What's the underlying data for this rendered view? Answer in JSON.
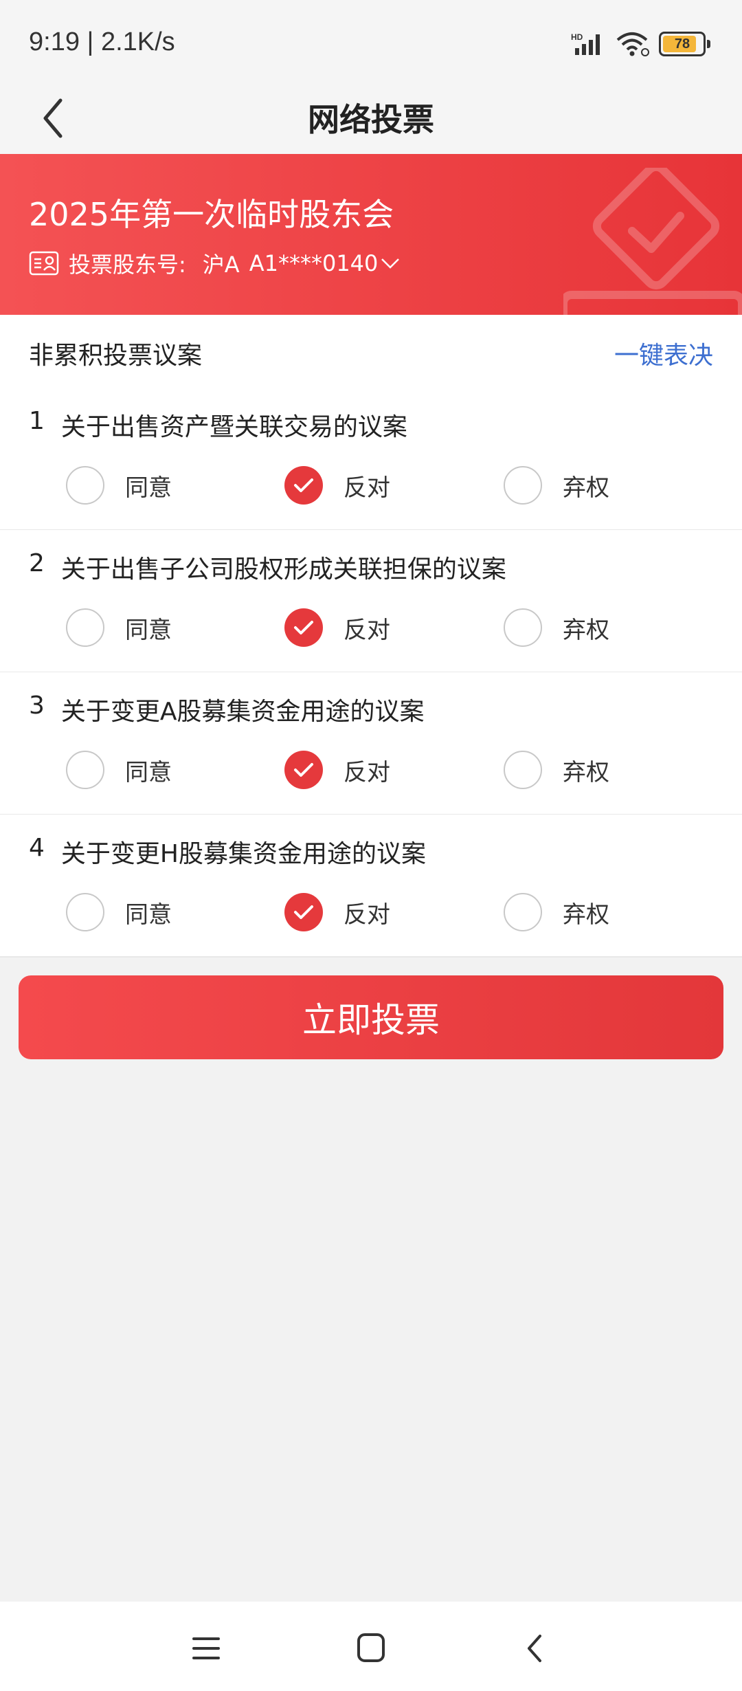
{
  "status_bar": {
    "time": "9:19 | 2.1K/s",
    "battery": "78",
    "hd_label": "HD"
  },
  "header": {
    "title": "网络投票"
  },
  "banner": {
    "meeting_title": "2025年第一次临时股东会",
    "account_label": "投票股东号:",
    "market": "沪A",
    "account_no": "A1****0140"
  },
  "section": {
    "title": "非累积投票议案",
    "one_key_label": "一键表决"
  },
  "options": {
    "agree": "同意",
    "oppose": "反对",
    "abstain": "弃权"
  },
  "proposals": [
    {
      "no": "1",
      "title": "关于出售资产暨关联交易的议案",
      "selected": "反对"
    },
    {
      "no": "2",
      "title": "关于出售子公司股权形成关联担保的议案",
      "selected": "反对"
    },
    {
      "no": "3",
      "title": "关于变更A股募集资金用途的议案",
      "selected": "反对"
    },
    {
      "no": "4",
      "title": "关于变更H股募集资金用途的议案",
      "selected": "反对"
    }
  ],
  "submit_label": "立即投票",
  "colors": {
    "brand_red": "#e5393c",
    "link_blue": "#3d6fd0"
  }
}
